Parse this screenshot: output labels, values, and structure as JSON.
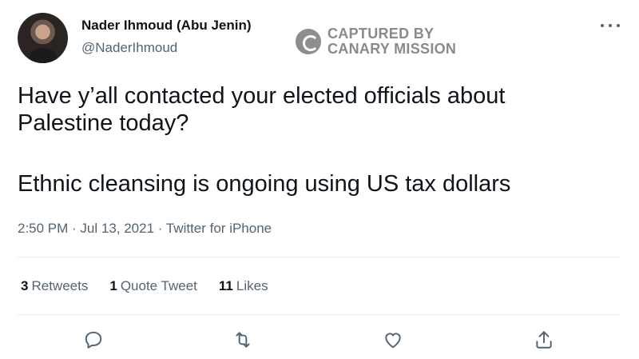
{
  "author": {
    "display_name": "Nader Ihmoud (Abu Jenin)",
    "handle": "@NaderIhmoud"
  },
  "watermark": {
    "line1": "CAPTURED BY",
    "line2": "CANARY MISSION"
  },
  "tweet": {
    "paragraph1_line1": "Have y’all contacted your elected officials about",
    "paragraph1_line2": "Palestine today?",
    "paragraph2": "Ethnic cleansing is ongoing using US tax dollars"
  },
  "meta": {
    "timestamp": "2:50 PM · Jul 13, 2021 · Twitter for iPhone"
  },
  "stats": {
    "retweets_count": "3",
    "retweets_label": "Retweets",
    "quotes_count": "1",
    "quotes_label": "Quote Tweet",
    "likes_count": "11",
    "likes_label": "Likes"
  },
  "icons": {
    "more": "more-icon",
    "reply": "reply-icon",
    "retweet": "retweet-icon",
    "like": "like-icon",
    "share": "share-icon"
  },
  "colors": {
    "text_primary": "#0f1419",
    "text_secondary": "#536471",
    "divider": "#e6ecf0",
    "watermark": "#8a8a8a"
  }
}
